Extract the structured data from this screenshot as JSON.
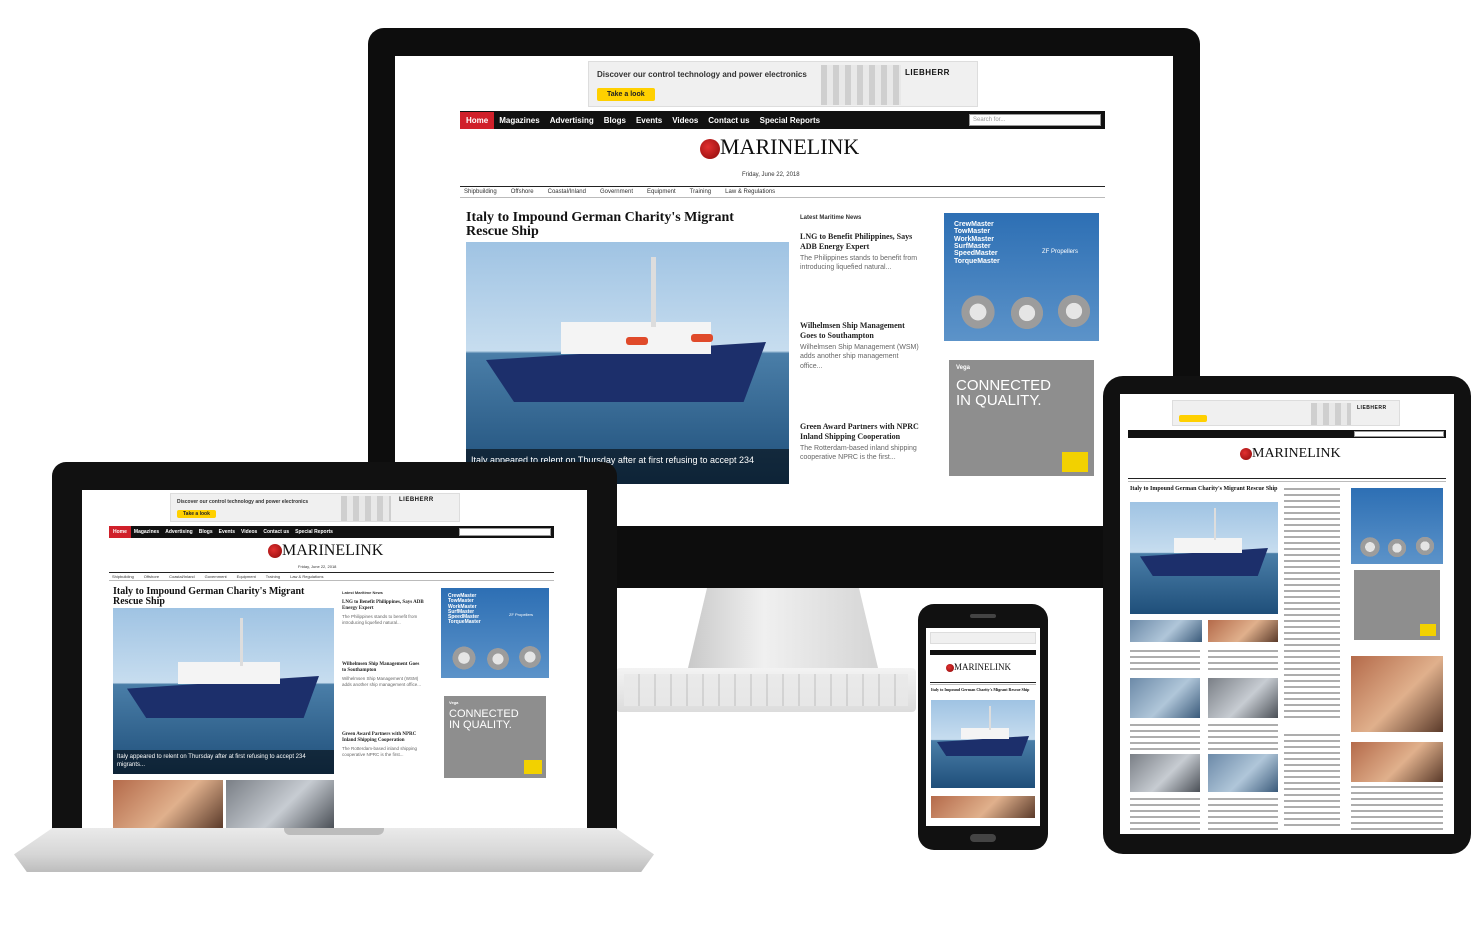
{
  "site": {
    "logo": "MARINELINK",
    "date": "Friday, June 22, 2018"
  },
  "top_ad": {
    "text": "Discover our control technology and power electronics",
    "button": "Take a look",
    "brand": "LIEBHERR"
  },
  "nav": {
    "items": [
      "Home",
      "Magazines",
      "Advertising",
      "Blogs",
      "Events",
      "Videos",
      "Contact us",
      "Special Reports"
    ],
    "search_placeholder": "Search for..."
  },
  "subnav": {
    "items": [
      "Shipbuilding",
      "Offshore",
      "Coastal/Inland",
      "Government",
      "Equipment",
      "Training",
      "Law & Regulations"
    ]
  },
  "main_story": {
    "headline": "Italy to Impound German Charity's Migrant Rescue Ship",
    "caption": "Italy appeared to relent on Thursday after at first refusing to accept 234 migrants..."
  },
  "latest_news": {
    "title": "Latest Maritime News",
    "items": [
      {
        "title": "LNG to Benefit Philippines, Says ADB Energy Expert",
        "summary": "The Philippines stands to benefit from introducing liquefied natural..."
      },
      {
        "title": "Wilhelmsen Ship Management Goes to Southampton",
        "summary": "Wilhelmsen Ship Management (WSM) adds another ship management office..."
      },
      {
        "title": "Green Award Partners with NPRC Inland Shipping Cooperation",
        "summary": "The Rotterdam-based inland shipping cooperative NPRC is the first..."
      }
    ]
  },
  "side_ad_1": {
    "lines": [
      "CrewMaster",
      "TowMaster",
      "WorkMaster",
      "SurfMaster",
      "SpeedMaster",
      "TorqueMaster"
    ],
    "brand": "ZF Propellers"
  },
  "side_ad_2": {
    "brand": "Vega",
    "text": "CONNECTED IN QUALITY."
  },
  "colors": {
    "accent_red": "#d0202a",
    "nav_black": "#111111",
    "ad_yellow": "#ffd000"
  }
}
